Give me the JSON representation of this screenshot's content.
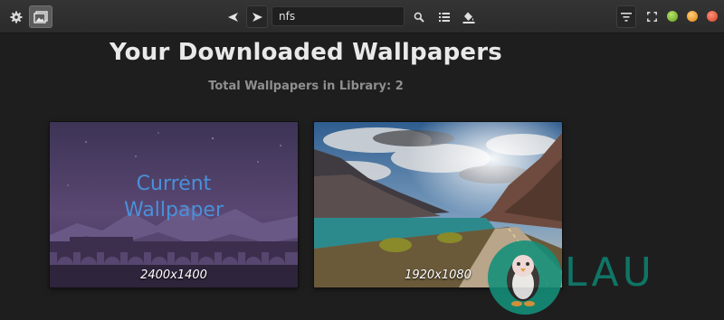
{
  "toolbar": {
    "search_value": "nfs",
    "icons": [
      "gear-icon",
      "gallery-icon",
      "back-arrow-icon",
      "forward-arrow-icon",
      "search-icon",
      "list-icon",
      "fill-color-icon",
      "filter-icon",
      "fullscreen-icon"
    ]
  },
  "window_controls": {
    "minimize_color": "#7fbf2a",
    "maximize_color": "#f09a1f",
    "close_color": "#e5502e"
  },
  "main": {
    "title": "Your Downloaded Wallpapers",
    "subtitle": "Total Wallpapers in Library: 2",
    "wallpapers": [
      {
        "current_label": "Current Wallpaper",
        "resolution": "2400x1400"
      },
      {
        "current_label": "",
        "resolution": "1920x1080"
      }
    ]
  },
  "watermark": {
    "text": "LAU",
    "color": "#13907a"
  },
  "colors": {
    "accent_blue": "#4a90d9",
    "background": "#1e1e1e"
  }
}
